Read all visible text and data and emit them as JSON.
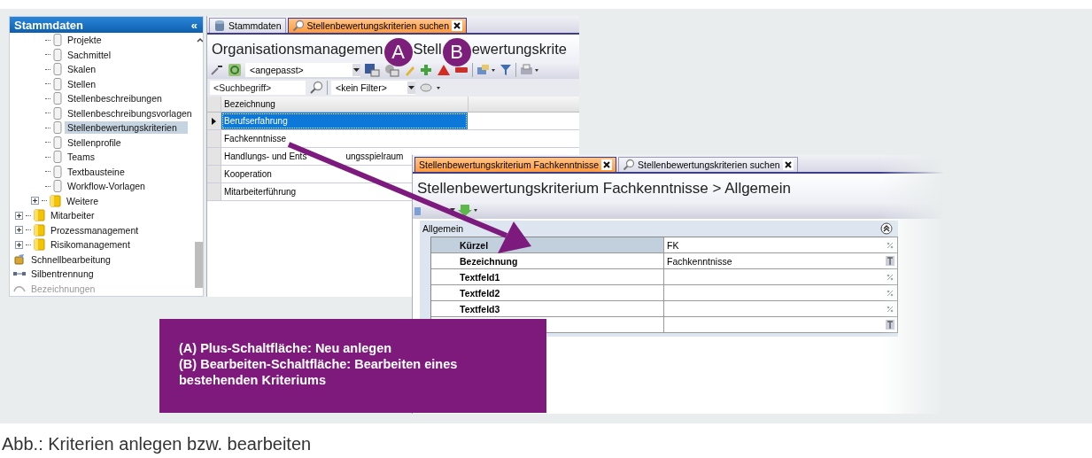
{
  "sidebar": {
    "title": "Stammdaten",
    "collapse_glyph": "«",
    "tree": [
      {
        "kind": "group",
        "children": [
          {
            "label": "Projekte",
            "kind": "page",
            "selected": false
          },
          {
            "label": "Sachmittel",
            "kind": "page",
            "selected": false
          },
          {
            "label": "Skalen",
            "kind": "page",
            "selected": false
          },
          {
            "label": "Stellen",
            "kind": "page",
            "selected": false
          },
          {
            "label": "Stellenbeschreibungen",
            "kind": "page",
            "selected": false
          },
          {
            "label": "Stellenbeschreibungsvorlagen",
            "kind": "page",
            "selected": false
          },
          {
            "label": "Stellenbewertungskriterien",
            "kind": "page",
            "selected": true
          },
          {
            "label": "Stellenprofile",
            "kind": "page",
            "selected": false
          },
          {
            "label": "Teams",
            "kind": "page",
            "selected": false
          },
          {
            "label": "Textbausteine",
            "kind": "page",
            "selected": false
          },
          {
            "label": "Workflow-Vorlagen",
            "kind": "page",
            "selected": false
          },
          {
            "label": "Weitere",
            "kind": "folder",
            "expanded": false,
            "selected": false
          }
        ]
      },
      {
        "label": "Mitarbeiter",
        "kind": "folder",
        "expanded": false,
        "selected": false
      },
      {
        "label": "Prozessmanagement",
        "kind": "folder",
        "expanded": false,
        "selected": false
      },
      {
        "label": "Risikomanagement",
        "kind": "folder",
        "expanded": false,
        "selected": false
      },
      {
        "label": "Schnellbearbeitung",
        "kind": "quick",
        "selected": false
      },
      {
        "label": "Silbentrennung",
        "kind": "hyphen",
        "selected": false
      },
      {
        "label": "Bezeichnungen",
        "kind": "labels",
        "selected": false
      }
    ]
  },
  "search_window": {
    "tabs": [
      {
        "label": "Stammdaten",
        "kind": "overview",
        "selected": false,
        "closable": false
      },
      {
        "label": "Stellenbewertungskriterien suchen",
        "kind": "search",
        "selected": true,
        "closable": true
      }
    ],
    "title_parts": [
      "Organisationsmanagemen",
      "Stell",
      "ewertungskrite"
    ],
    "view": "<angepasst>",
    "search": {
      "placeholder": "<Suchbegriff>"
    },
    "filter": "<kein Filter>",
    "table": {
      "columns": [
        "Bezeichnung"
      ],
      "rows": [
        {
          "parts": [
            "Berufserfahrung"
          ],
          "selected": true
        },
        {
          "parts": [
            "Fachkenntnisse"
          ],
          "selected": false
        },
        {
          "parts": [
            "Handlungs- und Ents",
            "ungsspielraum"
          ],
          "selected": false
        },
        {
          "parts": [
            "Kooperation"
          ],
          "selected": false
        },
        {
          "parts": [
            "Mitarbeiterführung"
          ],
          "selected": false
        }
      ]
    }
  },
  "detail_window": {
    "tabs": [
      {
        "label": "Stellenbewertungskriterium Fachkenntnisse",
        "kind": "detail",
        "selected": true,
        "closable": true
      },
      {
        "label": "Stellenbewertungskriterien suchen",
        "kind": "search",
        "selected": false,
        "closable": true
      }
    ],
    "title": "Stellenbewertungskriterium Fachkenntnisse > Allgemein",
    "group": {
      "title": "Allgemein",
      "expanded": true
    },
    "fields": [
      {
        "label": "Kürzel",
        "value": "FK",
        "kind": "code",
        "selected": true
      },
      {
        "label": "Bezeichnung",
        "value": "Fachkenntnisse",
        "kind": "text",
        "selected": false
      },
      {
        "label": "Textfeld1",
        "kind": "code",
        "selected": false
      },
      {
        "label": "Textfeld2",
        "kind": "code",
        "selected": false
      },
      {
        "label": "Textfeld3",
        "kind": "code",
        "selected": false
      },
      {
        "kind": "text",
        "selected": false
      }
    ]
  },
  "markers": [
    {
      "label": "A"
    },
    {
      "label": "B"
    }
  ],
  "callout": {
    "lines": [
      "(A) Plus-Schaltfläche: Neu anlegen",
      "(B) Bearbeiten-Schaltfläche: Bearbeiten eines bestehenden Kriteriums"
    ]
  },
  "caption": "Abb.: Kriterien anlegen bzw. bearbeiten"
}
